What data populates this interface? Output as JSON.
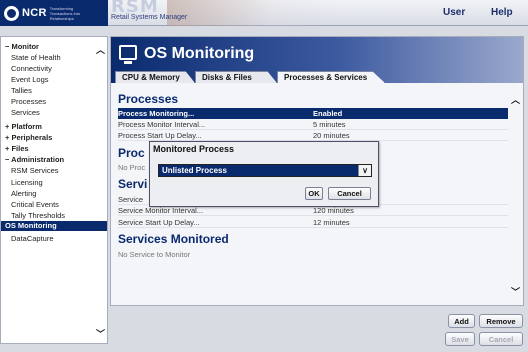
{
  "header": {
    "brand": "NCR",
    "brand_tagline": "Transforming Transactions into Relationships",
    "product": "RSM",
    "product_subtitle": "Retail Systems Manager",
    "nav": [
      "User",
      "Help"
    ]
  },
  "sidebar": {
    "items": [
      {
        "label": "− Monitor",
        "type": "group"
      },
      {
        "label": "State of Health",
        "type": "item"
      },
      {
        "label": "Connectivity",
        "type": "item"
      },
      {
        "label": "Event Logs",
        "type": "item"
      },
      {
        "label": "Tallies",
        "type": "item"
      },
      {
        "label": "Processes",
        "type": "item"
      },
      {
        "label": "Services",
        "type": "item"
      },
      {
        "label": "+ Platform",
        "type": "group"
      },
      {
        "label": "+ Peripherals",
        "type": "group"
      },
      {
        "label": "+ Files",
        "type": "group"
      },
      {
        "label": "− Administration",
        "type": "group"
      },
      {
        "label": "RSM Services",
        "type": "item"
      },
      {
        "label": "Licensing",
        "type": "item"
      },
      {
        "label": "Alerting",
        "type": "item"
      },
      {
        "label": "Critical Events",
        "type": "item"
      },
      {
        "label": "Tally Thresholds",
        "type": "item"
      },
      {
        "label": "OS Monitoring",
        "type": "selected"
      },
      {
        "label": "DataCapture",
        "type": "item"
      }
    ]
  },
  "main": {
    "title": "OS Monitoring",
    "tabs": [
      {
        "label": "CPU & Memory",
        "active": false
      },
      {
        "label": "Disks & Files",
        "active": false
      },
      {
        "label": "Processes & Services",
        "active": true
      }
    ],
    "processes": {
      "title": "Processes",
      "rows": [
        {
          "label": "Process Monitoring...",
          "value": "Enabled"
        },
        {
          "label": "Process Monitor Interval...",
          "value": "5 minutes"
        },
        {
          "label": "Process Start Up Delay...",
          "value": "20 minutes"
        }
      ]
    },
    "processes_monitored": {
      "title": "Proc",
      "note": "No Proc"
    },
    "services": {
      "title": "Servi",
      "rows": [
        {
          "label": "Service",
          "value": ""
        },
        {
          "label": "Service Monitor Interval...",
          "value": "120 minutes"
        },
        {
          "label": "Service Start Up Delay...",
          "value": "12 minutes"
        }
      ]
    },
    "services_monitored": {
      "title": "Services Monitored",
      "note": "No Service to Monitor"
    }
  },
  "buttons": {
    "add": "Add",
    "remove": "Remove",
    "save": "Save",
    "cancel": "Cancel"
  },
  "dialog": {
    "title": "Monitored Process",
    "selected_option": "Unlisted Process",
    "ok": "OK",
    "cancel": "Cancel"
  },
  "colors": {
    "navy": "#0a2a6e",
    "header_gradient_end": "#9aa8cc"
  }
}
